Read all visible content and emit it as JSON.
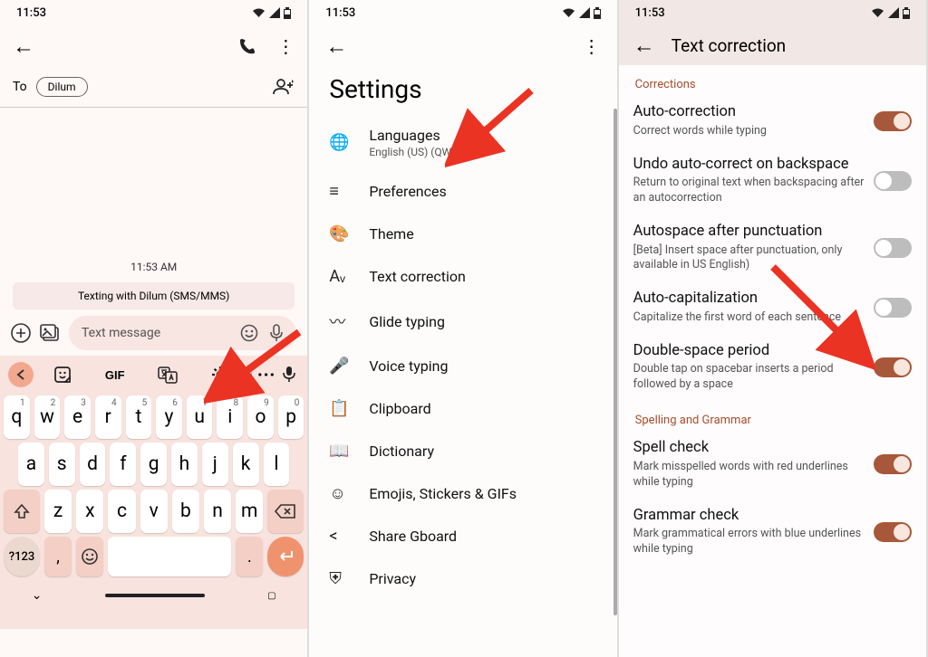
{
  "status": {
    "time": "11:53",
    "wifi": "▾",
    "signal": "◢",
    "battery": "▮"
  },
  "icons": {
    "wifi": "📶",
    "bat": "🔋"
  },
  "p1": {
    "to": "To",
    "chip": "Dilum",
    "timestamp": "11:53 AM",
    "notice": "Texting with Dilum (SMS/MMS)",
    "placeholder": "Text message",
    "gif": "GIF",
    "row1": [
      "q",
      "w",
      "e",
      "r",
      "t",
      "y",
      "u",
      "i",
      "o",
      "p"
    ],
    "nums": [
      "1",
      "2",
      "3",
      "4",
      "5",
      "6",
      "7",
      "8",
      "9",
      "0"
    ],
    "row2": [
      "a",
      "s",
      "d",
      "f",
      "g",
      "h",
      "j",
      "k",
      "l"
    ],
    "row3": [
      "z",
      "x",
      "c",
      "v",
      "b",
      "n",
      "m"
    ],
    "numkey": "?123",
    "comma": ",",
    "period": "."
  },
  "p2": {
    "title": "Settings",
    "items": [
      {
        "icon": "🌐",
        "label": "Languages",
        "sub": "English (US) (QWERTY)"
      },
      {
        "icon": "≡",
        "label": "Preferences"
      },
      {
        "icon": "🎨",
        "label": "Theme"
      },
      {
        "icon": "Aᵥ",
        "label": "Text correction"
      },
      {
        "icon": "〰",
        "label": "Glide typing"
      },
      {
        "icon": "🎤",
        "label": "Voice typing"
      },
      {
        "icon": "📋",
        "label": "Clipboard"
      },
      {
        "icon": "📖",
        "label": "Dictionary"
      },
      {
        "icon": "☺",
        "label": "Emojis, Stickers & GIFs"
      },
      {
        "icon": "<",
        "label": "Share Gboard"
      },
      {
        "icon": "⛨",
        "label": "Privacy"
      }
    ]
  },
  "p3": {
    "title": "Text correction",
    "sec1": "Corrections",
    "sec2": "Spelling and Grammar",
    "items": [
      {
        "t": "Auto-correction",
        "d": "Correct words while typing",
        "on": true
      },
      {
        "t": "Undo auto-correct on backspace",
        "d": "Return to original text when backspacing after an autocorrection",
        "on": false
      },
      {
        "t": "Autospace after punctuation",
        "d": "[Beta] Insert space after punctuation, only available in US English)",
        "on": false
      },
      {
        "t": "Auto-capitalization",
        "d": "Capitalize the first word of each sentence",
        "on": false
      },
      {
        "t": "Double-space period",
        "d": "Double tap on spacebar inserts a period followed by a space",
        "on": true
      }
    ],
    "items2": [
      {
        "t": "Spell check",
        "d": "Mark misspelled words with red underlines while typing",
        "on": true
      },
      {
        "t": "Grammar check",
        "d": "Mark grammatical errors with blue underlines while typing",
        "on": true
      }
    ]
  }
}
